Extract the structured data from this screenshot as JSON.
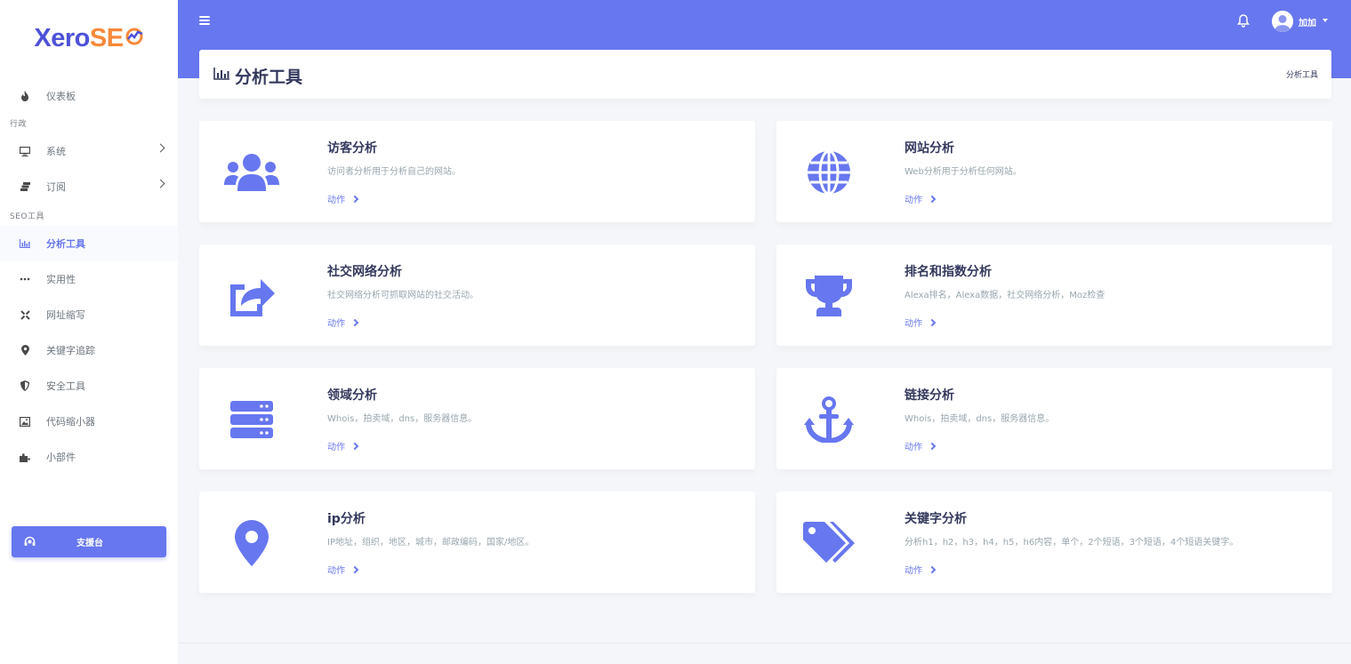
{
  "brand": {
    "logo_part1": "Xero",
    "logo_part2": "SE"
  },
  "sidebar": {
    "dashboard": "仪表板",
    "section_admin": "行政",
    "system": "系统",
    "subscription": "订阅",
    "section_seo": "SEO工具",
    "analysis_tools": "分析工具",
    "utility": "实用性",
    "url_shortener": "网址缩写",
    "keyword_tracking": "关键字追踪",
    "security_tools": "安全工具",
    "code_minifier": "代码缩小器",
    "widgets": "小部件",
    "support_desk": "支援台"
  },
  "header": {
    "user_name": "加加"
  },
  "page": {
    "title": "分析工具",
    "breadcrumb": "分析工具"
  },
  "cards": [
    {
      "title": "访客分析",
      "desc": "访问者分析用于分析自己的网站。",
      "action": "动作",
      "icon": "users-icon"
    },
    {
      "title": "网站分析",
      "desc": "Web分析用于分析任何网站。",
      "action": "动作",
      "icon": "globe-icon"
    },
    {
      "title": "社交网络分析",
      "desc": "社交网络分析可抓取网站的社交活动。",
      "action": "动作",
      "icon": "share-icon"
    },
    {
      "title": "排名和指数分析",
      "desc": "Alexa排名，Alexa数据，社交网络分析，Moz检查",
      "action": "动作",
      "icon": "trophy-icon"
    },
    {
      "title": "领域分析",
      "desc": "Whois，拍卖域，dns，服务器信息。",
      "action": "动作",
      "icon": "server-icon"
    },
    {
      "title": "链接分析",
      "desc": "Whois，拍卖域，dns，服务器信息。",
      "action": "动作",
      "icon": "anchor-icon"
    },
    {
      "title": "ip分析",
      "desc": "IP地址，组织，地区，城市，邮政编码，国家/地区。",
      "action": "动作",
      "icon": "map-marker-icon"
    },
    {
      "title": "关键字分析",
      "desc": "分析h1，h2，h3，h4，h5，h6内容，单个，2个短语，3个短语，4个短语关键字。",
      "action": "动作",
      "icon": "tags-icon"
    }
  ],
  "colors": {
    "primary": "#6777ef",
    "logo_blue": "#4d52d8",
    "logo_orange": "#f7893a",
    "background": "#f4f6f9"
  }
}
